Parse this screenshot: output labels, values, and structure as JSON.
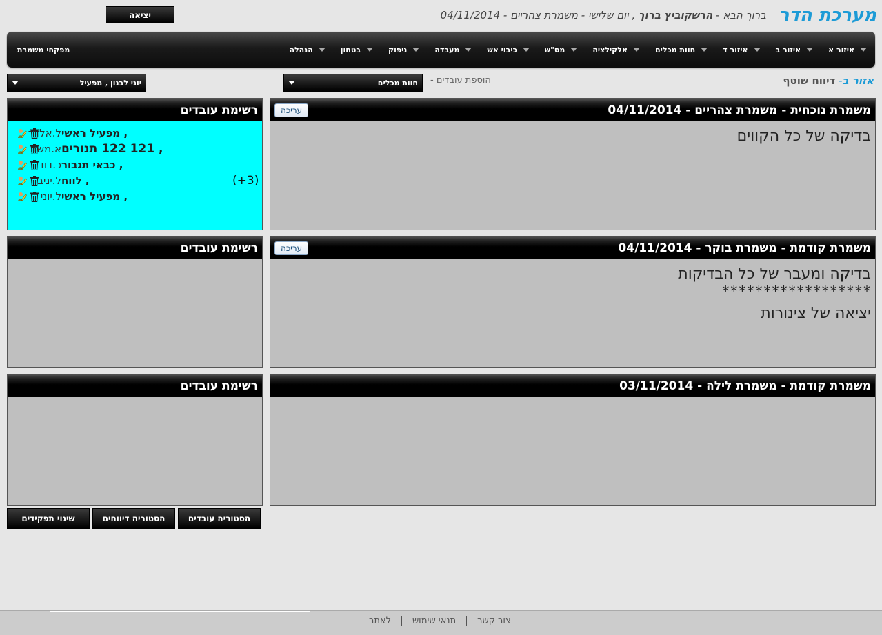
{
  "header": {
    "app_title": "מערכת הדר",
    "welcome_prefix": "ברוך הבא - ",
    "user_name": "הרשקוביץ ברוך",
    "welcome_suffix": " , יום שלישי - משמרת צהריים - 04/11/2014",
    "logout_label": "יציאה"
  },
  "nav": {
    "items": [
      {
        "label": "איזור א"
      },
      {
        "label": "איזור ב"
      },
      {
        "label": "איזור ד"
      },
      {
        "label": "חוות מכלים"
      },
      {
        "label": "אלקילציה"
      },
      {
        "label": "מס\"ש"
      },
      {
        "label": "כיבוי אש"
      },
      {
        "label": "מעבדה"
      },
      {
        "label": "ניפוק"
      },
      {
        "label": "בטחון"
      },
      {
        "label": "הנהלה"
      }
    ],
    "left_label": "מפקחי משמרת"
  },
  "subheader": {
    "area": "אזור ב",
    "sep": "- ",
    "report": "דיווח שוטף",
    "add_workers": "הוספת עובדים -",
    "area_select": "חוות מכלים",
    "worker_select": "יוני לבנון , מפעיל"
  },
  "shifts": [
    {
      "title": "משמרת נוכחית - משמרת צהריים - 04/11/2014",
      "edit_label": "עריכה",
      "lines": [
        "בדיקה של כל הקווים"
      ]
    },
    {
      "title": "משמרת קודמת - משמרת בוקר - 04/11/2014",
      "edit_label": "עריכה",
      "lines": [
        "בדיקה ומעבר של כל הבדיקות",
        "******************",
        "יציאה של צינורות"
      ]
    },
    {
      "title": "משמרת קודמת - משמרת לילה - 03/11/2014",
      "lines": []
    }
  ],
  "workers_panels": [
    {
      "title": "רשימת עובדים",
      "workers": [
        {
          "name": "ל.אלדד",
          "role": ", מפעיל ראשי",
          "extra": ""
        },
        {
          "name": "א.משה",
          "role": ", 121 122 תנורים",
          "extra": ""
        },
        {
          "name": "כ.דודו",
          "role": ", כבאי תגבור",
          "extra": ""
        },
        {
          "name": "ל.יניב",
          "role": ", לווח",
          "extra": "(3+)"
        },
        {
          "name": "ל.יוני",
          "role": ", מפעיל ראשי",
          "extra": ""
        }
      ]
    },
    {
      "title": "רשימת עובדים",
      "workers": []
    },
    {
      "title": "רשימת עובדים",
      "workers": []
    }
  ],
  "buttons": {
    "history_workers": "הסטוריה עובדים",
    "history_reports": "הסטוריה דיווחים",
    "role_changes": "שינוי תפקידים"
  },
  "footer": {
    "contact": "צור קשר",
    "terms": "תנאי שימוש",
    "to_site": "לאתר"
  },
  "colors": {
    "accent": "#1d9bd6",
    "active_panel": "#00ffff",
    "panel_bg": "#bfbfbf"
  }
}
